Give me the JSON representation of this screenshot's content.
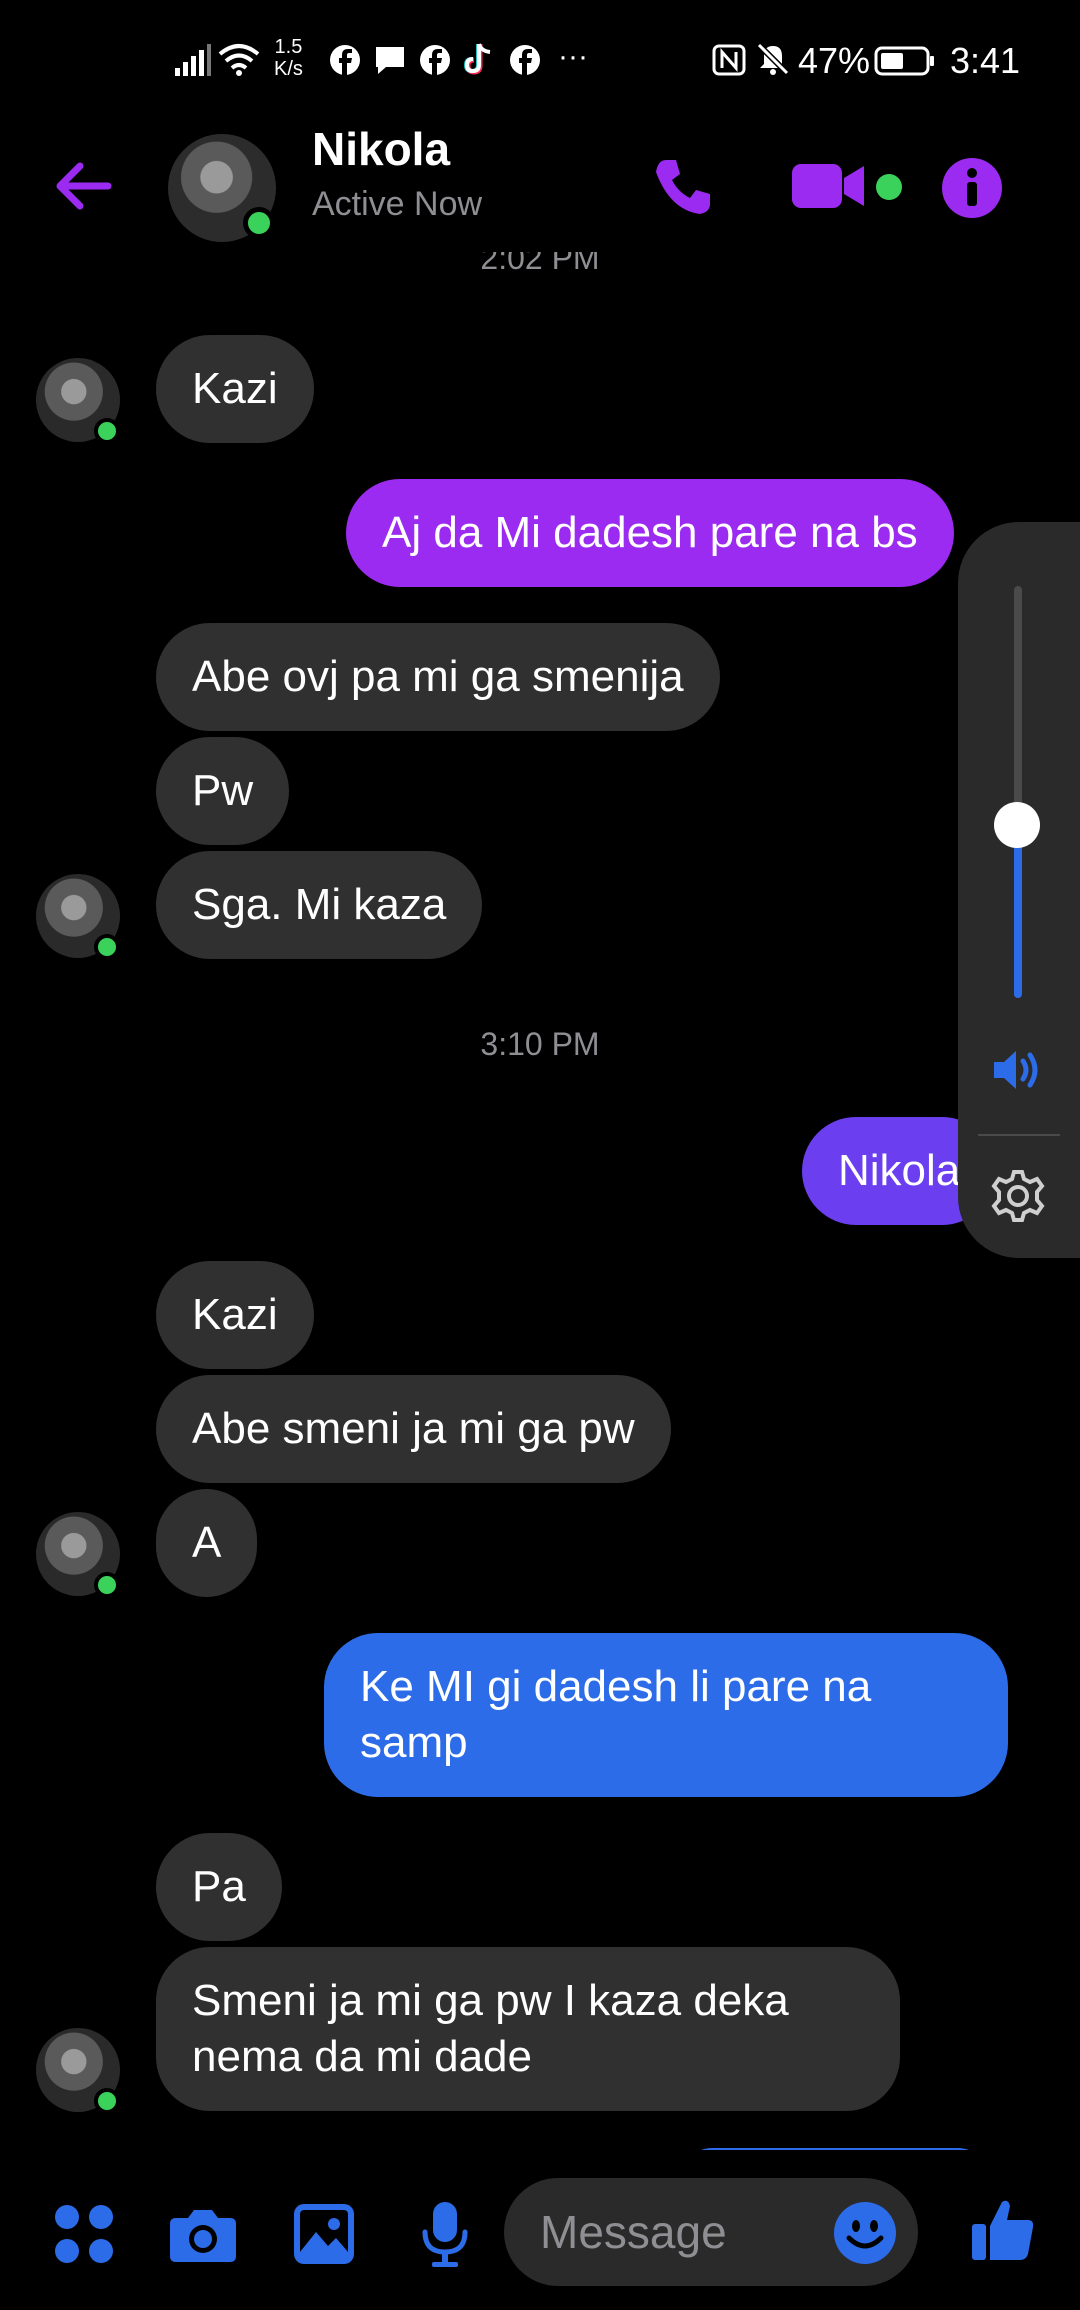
{
  "status_bar": {
    "net_speed_top": "1.5",
    "net_speed_bottom": "K/s",
    "more": "···",
    "battery": "47%",
    "time": "3:41"
  },
  "header": {
    "name": "Nikola",
    "status": "Active Now",
    "partial_time_top": "2:02 PM"
  },
  "colors": {
    "accent_purple": "#9b2bf0",
    "bubble_in": "#303030",
    "bubble_blue": "#2d6ce8",
    "bubble_violet": "#6b3ff0",
    "online_green": "#3ad25a"
  },
  "messages": [
    {
      "dir": "in",
      "text": "Kazi"
    },
    {
      "dir": "out",
      "text": "Aj da Mi dadesh pare na bs"
    },
    {
      "dir": "in",
      "text": "Abe ovj pa mi ga smenija"
    },
    {
      "dir": "in",
      "text": "Pw"
    },
    {
      "dir": "in",
      "text": "Sga. Mi kaza"
    },
    {
      "dir": "time",
      "text": "3:10 PM"
    },
    {
      "dir": "out",
      "text": "Nikola"
    },
    {
      "dir": "in",
      "text": "Kazi"
    },
    {
      "dir": "in",
      "text": "Abe smeni ja mi ga pw"
    },
    {
      "dir": "in",
      "text": "A"
    },
    {
      "dir": "out",
      "text": "Ke MI gi dadesh li pare na samp"
    },
    {
      "dir": "in",
      "text": "Pa"
    },
    {
      "dir": "in",
      "text": "Smeni ja mi ga pw I kaza deka nema da mi dade"
    }
  ],
  "volume": {
    "level": 0.42
  },
  "composer": {
    "placeholder": "Message"
  },
  "icons": [
    "back-arrow-icon",
    "phone-icon",
    "video-icon",
    "info-icon",
    "apps-icon",
    "camera-icon",
    "gallery-icon",
    "mic-icon",
    "emoji-icon",
    "like-icon",
    "volume-icon",
    "settings-icon"
  ]
}
